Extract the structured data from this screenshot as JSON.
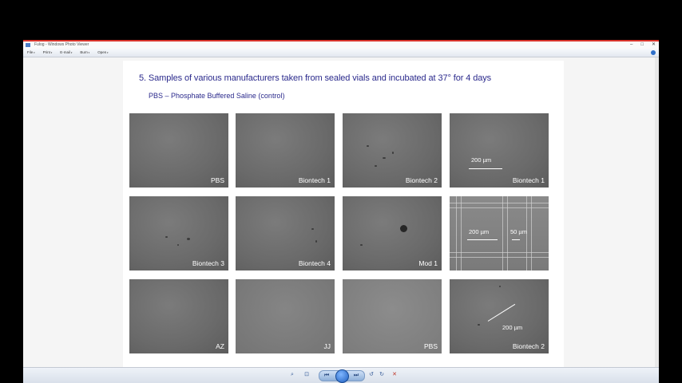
{
  "window": {
    "title": "Fulog - Windows Photo Viewer",
    "controls": [
      "–",
      "□",
      "✕"
    ]
  },
  "menu": [
    "File",
    "Print",
    "E-mail",
    "Burn",
    "Open"
  ],
  "page": {
    "heading": "5. Samples of various manufacturers taken from sealed vials and incubated at 37° for 4 days",
    "subheading": "PBS – Phosphate Buffered Saline (control)",
    "panels": [
      {
        "label": "PBS"
      },
      {
        "label": "Biontech 1"
      },
      {
        "label": "Biontech 2"
      },
      {
        "label": "Biontech 1",
        "scale": "200 µm"
      },
      {
        "label": "Biontech 3"
      },
      {
        "label": "Biontech 4"
      },
      {
        "label": "Mod 1"
      },
      {
        "label": "",
        "scale": "200 µm",
        "scale2": "50 µm"
      },
      {
        "label": "AZ"
      },
      {
        "label": "JJ"
      },
      {
        "label": "PBS"
      },
      {
        "label": "Biontech 2",
        "scale": "200 µm"
      }
    ]
  },
  "toolbar": {
    "zoom": "⌕",
    "fit": "⊡",
    "prev": "⏮",
    "next": "⏭",
    "rotate_ccw": "↺",
    "rotate_cw": "↻",
    "delete": "✕"
  }
}
